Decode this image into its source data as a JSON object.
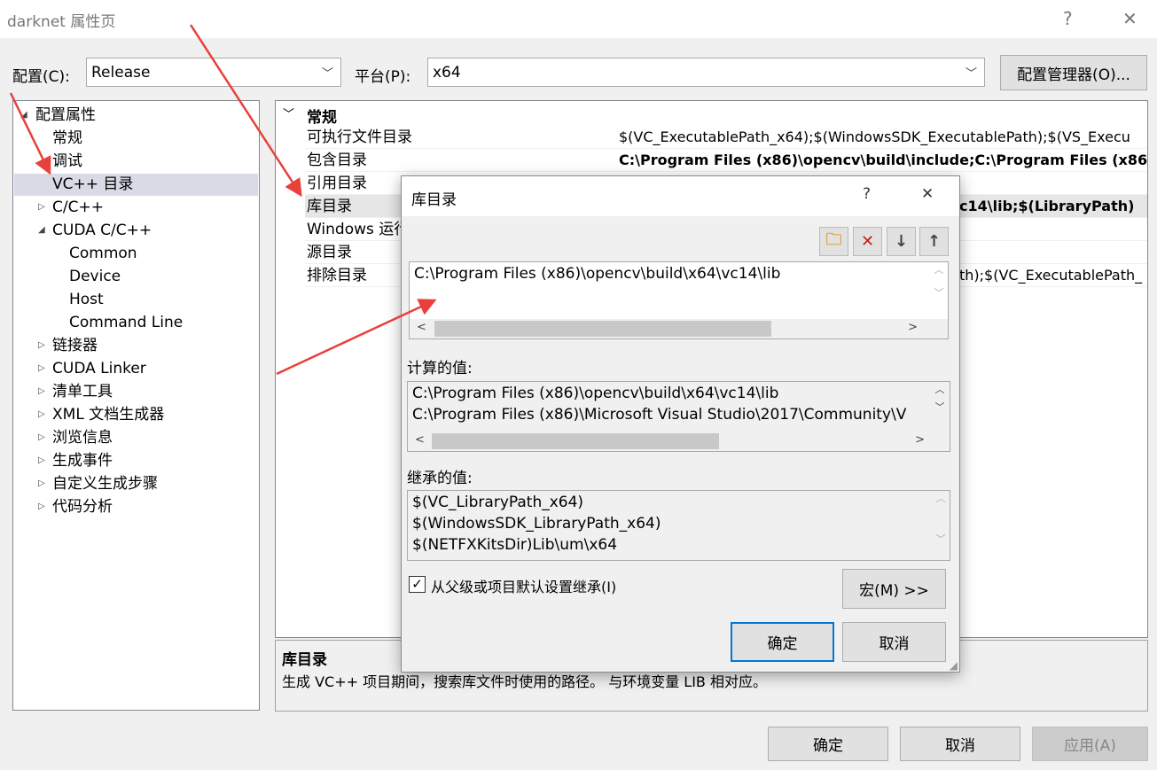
{
  "window": {
    "title": "darknet 属性页",
    "help": "?",
    "close": "✕"
  },
  "config": {
    "config_label": "配置(C):",
    "config_value": "Release",
    "platform_label": "平台(P):",
    "platform_value": "x64",
    "manager_button": "配置管理器(O)..."
  },
  "tree": {
    "items": [
      {
        "label": "配置属性",
        "level": 0,
        "arrow": "◢"
      },
      {
        "label": "常规",
        "level": 1,
        "arrow": ""
      },
      {
        "label": "调试",
        "level": 1,
        "arrow": ""
      },
      {
        "label": "VC++ 目录",
        "level": 1,
        "arrow": "",
        "selected": true
      },
      {
        "label": "C/C++",
        "level": 1,
        "arrow": "▷"
      },
      {
        "label": "CUDA C/C++",
        "level": 1,
        "arrow": "◢"
      },
      {
        "label": "Common",
        "level": 2,
        "arrow": ""
      },
      {
        "label": "Device",
        "level": 2,
        "arrow": ""
      },
      {
        "label": "Host",
        "level": 2,
        "arrow": ""
      },
      {
        "label": "Command Line",
        "level": 2,
        "arrow": ""
      },
      {
        "label": "链接器",
        "level": 1,
        "arrow": "▷"
      },
      {
        "label": "CUDA Linker",
        "level": 1,
        "arrow": "▷"
      },
      {
        "label": "清单工具",
        "level": 1,
        "arrow": "▷"
      },
      {
        "label": "XML 文档生成器",
        "level": 1,
        "arrow": "▷"
      },
      {
        "label": "浏览信息",
        "level": 1,
        "arrow": "▷"
      },
      {
        "label": "生成事件",
        "level": 1,
        "arrow": "▷"
      },
      {
        "label": "自定义生成步骤",
        "level": 1,
        "arrow": "▷"
      },
      {
        "label": "代码分析",
        "level": 1,
        "arrow": "▷"
      }
    ]
  },
  "grid": {
    "section": "常规",
    "rows": [
      {
        "key": "可执行文件目录",
        "value": "$(VC_ExecutablePath_x64);$(WindowsSDK_ExecutablePath);$(VS_Execu",
        "bold": false
      },
      {
        "key": "包含目录",
        "value": "C:\\Program Files (x86)\\opencv\\build\\include;C:\\Program Files (x86",
        "bold": true
      },
      {
        "key": "引用目录",
        "value": "",
        "bold": false
      },
      {
        "key": "库目录",
        "value": "c14\\lib;$(LibraryPath)",
        "bold": true,
        "selected": true
      },
      {
        "key": "Windows 运行",
        "value": "",
        "bold": false
      },
      {
        "key": "源目录",
        "value": "",
        "bold": false
      },
      {
        "key": "排除目录",
        "value": "th);$(VC_ExecutablePath_",
        "bold": false
      }
    ]
  },
  "description": {
    "title": "库目录",
    "text": "生成 VC++ 项目期间，搜索库文件时使用的路径。 与环境变量 LIB 相对应。"
  },
  "footer": {
    "ok": "确定",
    "cancel": "取消",
    "apply": "应用(A)"
  },
  "dialog": {
    "title": "库目录",
    "help": "?",
    "close": "✕",
    "toolbar": [
      "new-folder-icon",
      "delete-icon",
      "move-down-icon",
      "move-up-icon"
    ],
    "edit_lines": [
      "C:\\Program Files (x86)\\opencv\\build\\x64\\vc14\\lib"
    ],
    "computed_label": "计算的值:",
    "computed_lines": [
      "C:\\Program Files (x86)\\opencv\\build\\x64\\vc14\\lib",
      "C:\\Program Files (x86)\\Microsoft Visual Studio\\2017\\Community\\V"
    ],
    "inherited_label": "继承的值:",
    "inherited_lines": [
      "$(VC_LibraryPath_x64)",
      "$(WindowsSDK_LibraryPath_x64)",
      "$(NETFXKitsDir)Lib\\um\\x64"
    ],
    "inherit_checkbox": "从父级或项目默认设置继承(I)",
    "inherit_checked": true,
    "macros_button": "宏(M) >>",
    "ok": "确定",
    "cancel": "取消"
  },
  "colors": {
    "accent": "#0078d7",
    "annotation_arrow": "#e8403a",
    "selection": "#dadae6"
  }
}
